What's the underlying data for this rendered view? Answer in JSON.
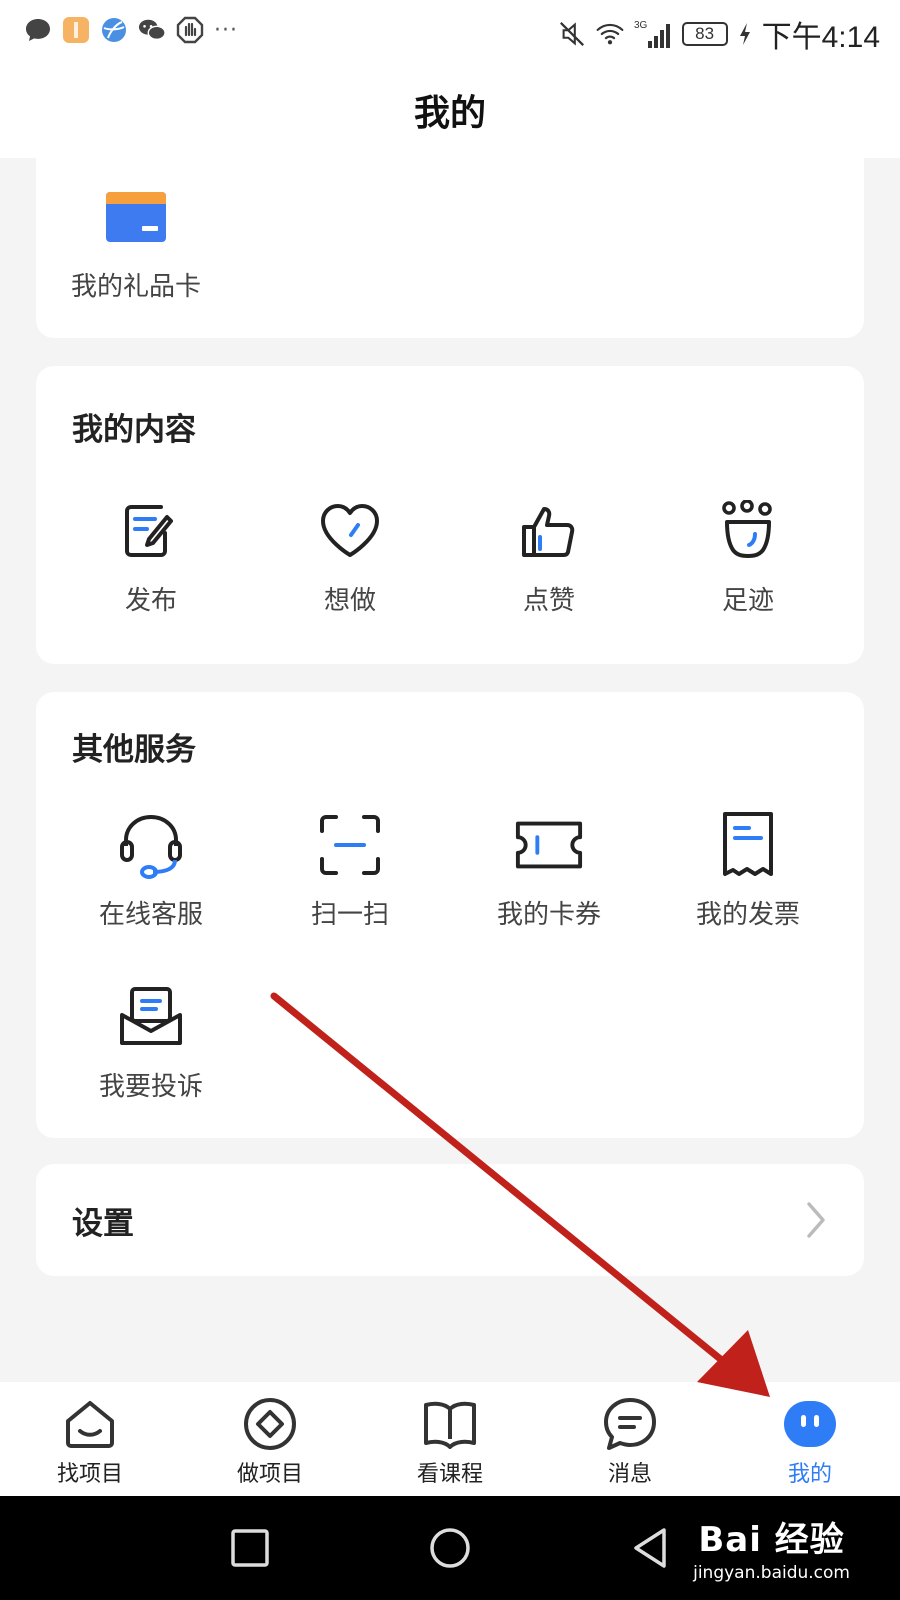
{
  "status_bar": {
    "time": "下午4:14",
    "battery": "83",
    "network": "3G",
    "notification_icons": [
      "chat-bubble-icon",
      "app-icon",
      "browser-icon",
      "wechat-icon",
      "hand-icon"
    ],
    "more": "···"
  },
  "header": {
    "title": "我的"
  },
  "gift_card": {
    "label": "我的礼品卡",
    "icon": "gift-card-icon"
  },
  "my_content": {
    "title": "我的内容",
    "items": [
      {
        "label": "发布",
        "icon": "edit-note-icon"
      },
      {
        "label": "想做",
        "icon": "heart-icon"
      },
      {
        "label": "点赞",
        "icon": "thumbs-up-icon"
      },
      {
        "label": "足迹",
        "icon": "footprint-icon"
      }
    ]
  },
  "other_services": {
    "title": "其他服务",
    "items": [
      {
        "label": "在线客服",
        "icon": "headset-icon"
      },
      {
        "label": "扫一扫",
        "icon": "scan-icon"
      },
      {
        "label": "我的卡券",
        "icon": "ticket-icon"
      },
      {
        "label": "我的发票",
        "icon": "receipt-icon"
      },
      {
        "label": "我要投诉",
        "icon": "mail-tray-icon"
      }
    ]
  },
  "settings": {
    "label": "设置"
  },
  "tab_bar": {
    "tabs": [
      {
        "label": "找项目",
        "icon": "home-smile-icon",
        "active": false
      },
      {
        "label": "做项目",
        "icon": "diamond-circle-icon",
        "active": false
      },
      {
        "label": "看课程",
        "icon": "book-icon",
        "active": false
      },
      {
        "label": "消息",
        "icon": "message-icon",
        "active": false
      },
      {
        "label": "我的",
        "icon": "profile-face-icon",
        "active": true
      }
    ]
  },
  "watermark": {
    "line1": "Bai 经验",
    "line2": "jingyan.baidu.com"
  },
  "colors": {
    "accent": "#2f7df6",
    "arrow": "#c0221b",
    "gift_orange": "#f5a03c",
    "gift_blue": "#3f7bf0"
  }
}
